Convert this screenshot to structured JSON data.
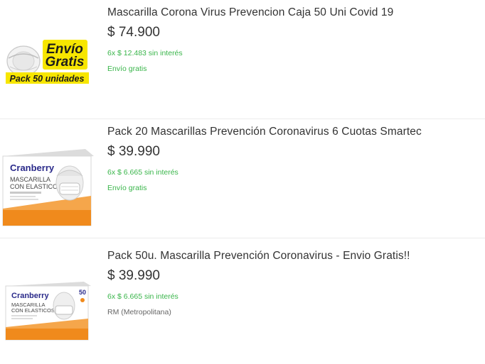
{
  "colors": {
    "text": "#333333",
    "green": "#39b54a",
    "muted": "#666666",
    "divider": "#ececec",
    "badge_yellow": "#f7e600",
    "box_orange": "#f08a1c"
  },
  "items": [
    {
      "title": "Mascarilla Corona Virus Prevencion Caja 50 Uni Covid 19",
      "price": "$ 74.900",
      "installments": "6x $ 12.483 sin interés",
      "shipping": "Envío gratis",
      "image": {
        "icon": "mask-envio-gratis-image",
        "badge_line1": "Envío",
        "badge_line2": "Gratis",
        "badge_line3": "Pack 50 unidades"
      }
    },
    {
      "title": "Pack 20 Mascarillas Prevención Coronavirus 6 Cuotas Smartec",
      "price": "$ 39.990",
      "installments": "6x $ 6.665 sin interés",
      "shipping": "Envío gratis",
      "image": {
        "icon": "cranberry-mask-box-image",
        "brand": "Cranberry",
        "line1": "MASCARILLA",
        "line2": "CON ELASTICOS"
      }
    },
    {
      "title": "Pack 50u. Mascarilla Prevención Coronavirus - Envio Gratis!!",
      "price": "$ 39.990",
      "installments": "6x $ 6.665 sin interés",
      "shipping": "RM (Metropolitana)",
      "image": {
        "icon": "cranberry-mask-box-image",
        "brand": "Cranberry",
        "line1": "MASCARILLA",
        "line2": "CON ELASTICOS",
        "count": "50"
      }
    }
  ]
}
